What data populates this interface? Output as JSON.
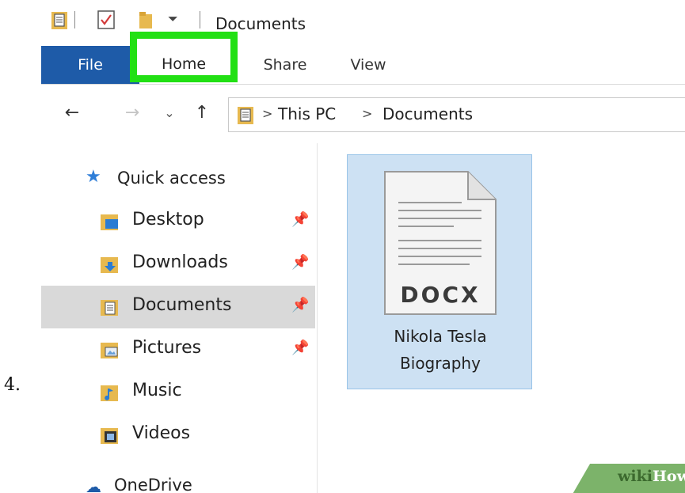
{
  "step_number": "4.",
  "window": {
    "title": "Documents"
  },
  "ribbon": {
    "tabs": [
      {
        "label": "File",
        "active": false
      },
      {
        "label": "Home",
        "highlighted": true
      },
      {
        "label": "Share",
        "active": false
      },
      {
        "label": "View",
        "active": false
      }
    ],
    "highlight_color": "#22e014",
    "file_tab_color": "#1e5ba8"
  },
  "nav": {
    "back_icon": "←",
    "forward_icon": "→",
    "recent_icon": "⌄",
    "up_icon": "↑",
    "breadcrumb": [
      "This PC",
      "Documents"
    ],
    "separator": ">"
  },
  "sidebar": {
    "quick_access_label": "Quick access",
    "items": [
      {
        "label": "Desktop",
        "icon": "desktop-folder-icon",
        "pinned": true,
        "selected": false
      },
      {
        "label": "Downloads",
        "icon": "downloads-folder-icon",
        "pinned": true,
        "selected": false
      },
      {
        "label": "Documents",
        "icon": "documents-folder-icon",
        "pinned": true,
        "selected": true
      },
      {
        "label": "Pictures",
        "icon": "pictures-folder-icon",
        "pinned": true,
        "selected": false
      },
      {
        "label": "Music",
        "icon": "music-folder-icon",
        "pinned": false,
        "selected": false
      },
      {
        "label": "Videos",
        "icon": "videos-folder-icon",
        "pinned": false,
        "selected": false
      }
    ],
    "onedrive_label": "OneDrive",
    "selected_bg": "#d9d9d9"
  },
  "content": {
    "file": {
      "badge": "DOCX",
      "name_line1": "Nikola Tesla",
      "name_line2": "Biography",
      "selected_bg": "#cde1f3"
    }
  },
  "watermark": {
    "part1": "wiki",
    "part2": "How"
  }
}
